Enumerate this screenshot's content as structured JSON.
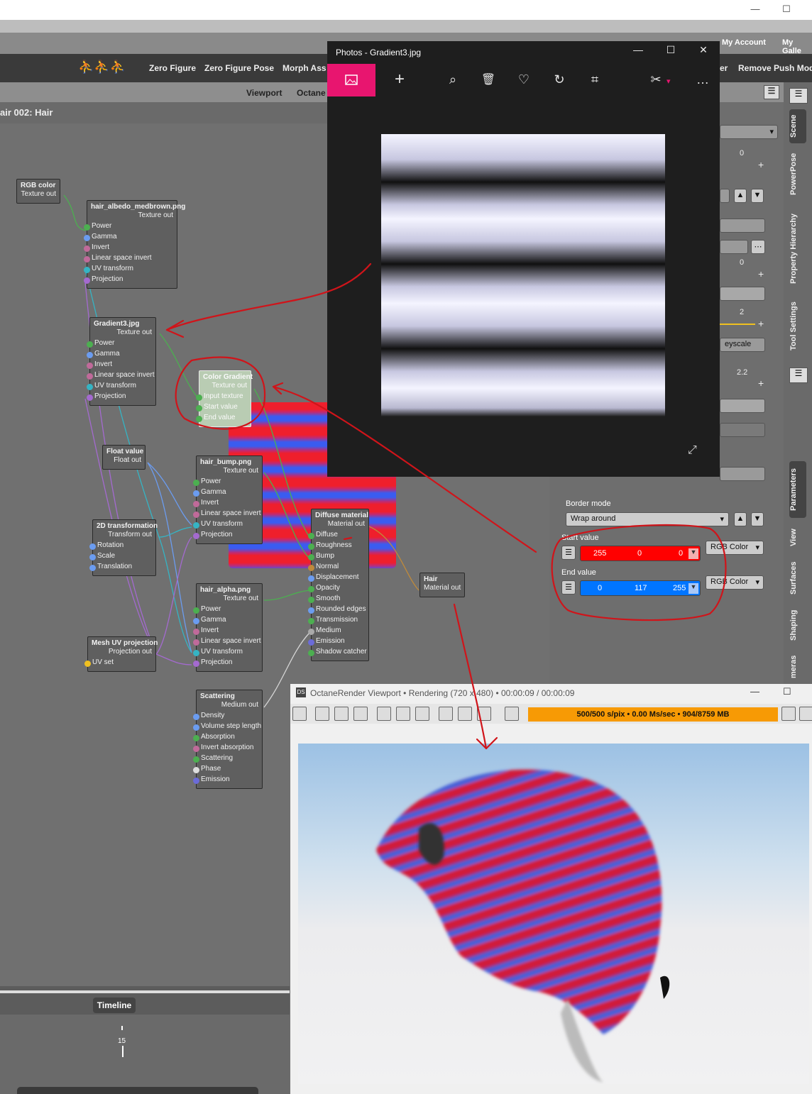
{
  "app": {
    "my_account": "My Account",
    "my_gallery": "My Galle"
  },
  "toolbar": {
    "zero_figure": "Zero Figure",
    "zero_figure_pose": "Zero Figure Pose",
    "morph_assets": "Morph Ass",
    "er": "er",
    "remove_push": "Remove Push Mod"
  },
  "tabs": {
    "viewport": "Viewport",
    "octane": "Octane"
  },
  "path": "air 002: Hair",
  "nodes": {
    "rgb": {
      "title": "RGB color",
      "out": "Texture out"
    },
    "albedo": {
      "title": "hair_albedo_medbrown.png",
      "out": "Texture out",
      "inputs": [
        "Power",
        "Gamma",
        "Invert",
        "Linear space invert",
        "UV transform",
        "Projection"
      ]
    },
    "gradient3": {
      "title": "Gradient3.jpg",
      "out": "Texture out",
      "inputs": [
        "Power",
        "Gamma",
        "Invert",
        "Linear space invert",
        "UV transform",
        "Projection"
      ]
    },
    "colorgrad": {
      "title": "Color Gradient",
      "out": "Texture out",
      "inputs": [
        "Input texture",
        "Start value",
        "End value"
      ]
    },
    "floatv": {
      "title": "Float value",
      "out": "Float out"
    },
    "bump": {
      "title": "hair_bump.png",
      "out": "Texture out",
      "inputs": [
        "Power",
        "Gamma",
        "Invert",
        "Linear space invert",
        "UV transform",
        "Projection"
      ]
    },
    "t2d": {
      "title": "2D transformation",
      "out": "Transform out",
      "inputs": [
        "Rotation",
        "Scale",
        "Translation"
      ]
    },
    "diffuse": {
      "title": "Diffuse material",
      "out": "Material out",
      "inputs": [
        "Diffuse",
        "Roughness",
        "Bump",
        "Normal",
        "Displacement",
        "Opacity",
        "Smooth",
        "Rounded edges",
        "Transmission",
        "Medium",
        "Emission",
        "Shadow catcher"
      ]
    },
    "hair": {
      "title": "Hair",
      "out": "Material out"
    },
    "alpha": {
      "title": "hair_alpha.png",
      "out": "Texture out",
      "inputs": [
        "Power",
        "Gamma",
        "Invert",
        "Linear space invert",
        "UV transform",
        "Projection"
      ]
    },
    "meshuv": {
      "title": "Mesh UV projection",
      "out": "Projection out",
      "inputs": [
        "UV set"
      ]
    },
    "scatter": {
      "title": "Scattering",
      "out": "Medium out",
      "inputs": [
        "Density",
        "Volume step length",
        "Absorption",
        "Invert absorption",
        "Scattering",
        "Phase",
        "Emission"
      ]
    }
  },
  "photos": {
    "title": "Photos - Gradient3.jpg",
    "more": "…"
  },
  "params": {
    "v0a": "0",
    "v0b": "0",
    "v2": "2",
    "greyscale": "eyscale",
    "v22": "2.2",
    "border_mode_label": "Border mode",
    "border_mode": "Wrap around",
    "start_label": "Start value",
    "start": [
      "255",
      "0",
      "0"
    ],
    "start_type": "RGB Color",
    "end_label": "End value",
    "end": [
      "0",
      "117",
      "255"
    ],
    "end_type": "RGB Color"
  },
  "sidetabs": [
    "Scene",
    "PowerPose",
    "Property Hierarchy",
    "Tool Settings",
    "Parameters",
    "View",
    "Surfaces",
    "Shaping",
    "meras"
  ],
  "octane": {
    "title": "OctaneRender Viewport • Rendering (720 x 480) • 00:00:09 / 00:00:09",
    "status": "500/500 s/pix • 0.00 Ms/sec • 904/8759 MB"
  },
  "timeline": {
    "label": "Timeline",
    "frame": "15"
  },
  "colors": {
    "accent_pink": "#e8156f",
    "status_orange": "#f79a05",
    "start_red": "#ff0000",
    "end_blue": "#0075ff",
    "annotation_red": "#d0141a"
  }
}
